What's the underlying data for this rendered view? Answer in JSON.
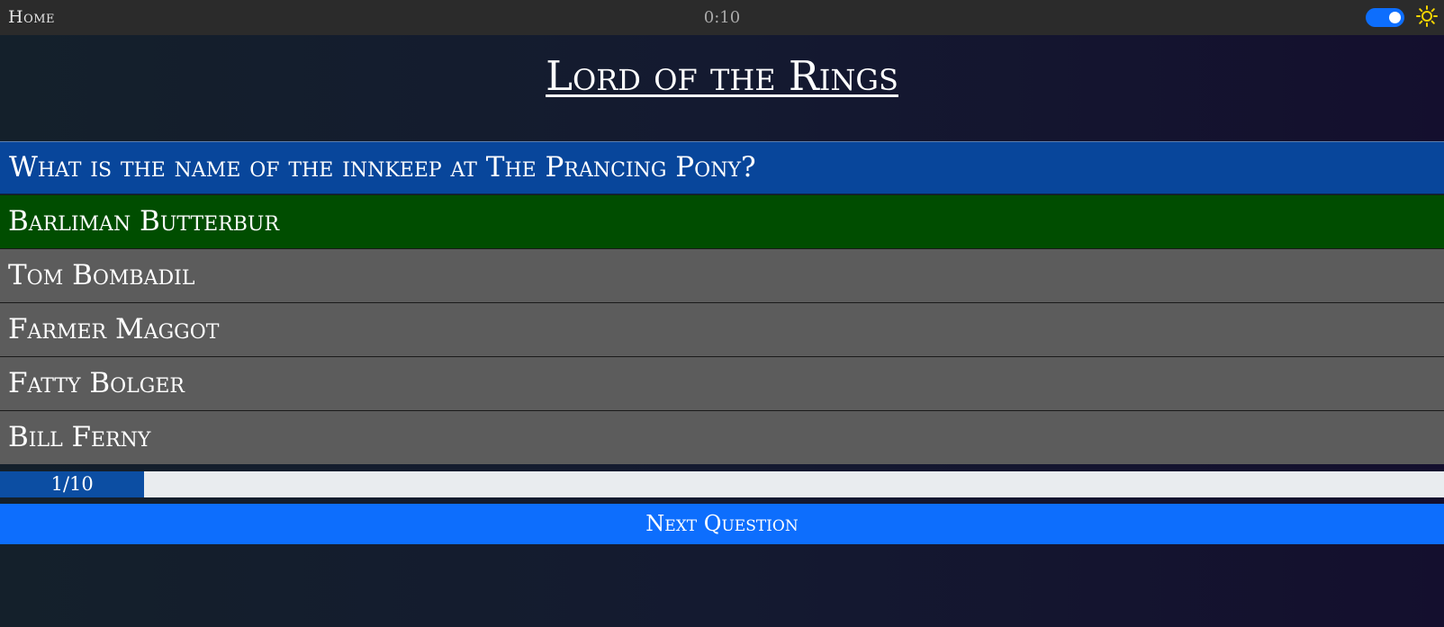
{
  "nav": {
    "home_label": "Home",
    "timer": "0:10"
  },
  "theme": {
    "toggle_on": true,
    "toggle_color": "#0d6efd",
    "icon": "sun-icon",
    "icon_color": "#f5d400"
  },
  "quiz": {
    "title": "Lord of the Rings",
    "question": "What is the name of the innkeep at The Prancing Pony?",
    "answers": [
      {
        "label": "Barliman Butterbur",
        "state": "correct"
      },
      {
        "label": "Tom Bombadil",
        "state": "default"
      },
      {
        "label": "Farmer Maggot",
        "state": "default"
      },
      {
        "label": "Fatty Bolger",
        "state": "default"
      },
      {
        "label": "Bill Ferny",
        "state": "default"
      }
    ],
    "colors": {
      "question_bg": "#08469b",
      "correct_bg": "#004d00",
      "answer_bg": "#5c5c5c"
    }
  },
  "progress": {
    "label": "1/10",
    "current": 1,
    "total": 10,
    "fraction": 0.1
  },
  "next_button": {
    "label": "Next Question"
  }
}
